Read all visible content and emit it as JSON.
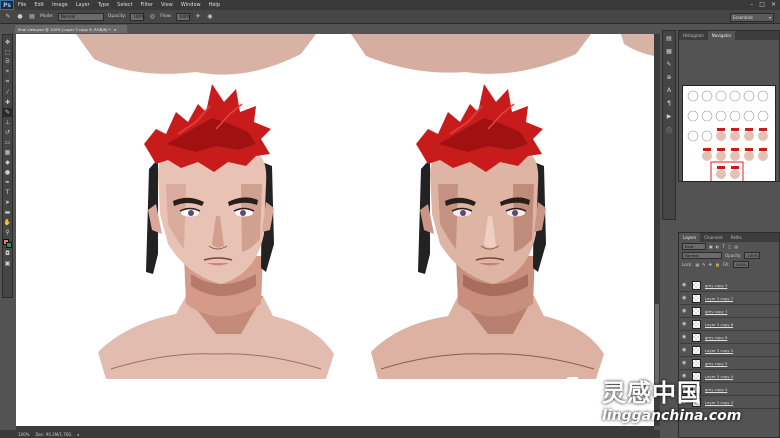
{
  "menubar": {
    "logo": "Ps",
    "items": [
      "File",
      "Edit",
      "Image",
      "Layer",
      "Type",
      "Select",
      "Filter",
      "View",
      "Window",
      "Help"
    ]
  },
  "options": {
    "mode_label": "Mode:",
    "mode_value": "Normal",
    "opacity_label": "Opacity:",
    "opacity_value": "100%",
    "flow_label": "Flow:",
    "flow_value": "100%",
    "workspace": "Essentials"
  },
  "document": {
    "tab_label": "final view.psd @ 100% (Layer 3 copy 6, RGB/8) *"
  },
  "statusbar": {
    "zoom": "100%",
    "doc_size": "Doc: 96.2M/1.76G"
  },
  "navigator": {
    "tabs": [
      "Histogram",
      "Navigator"
    ]
  },
  "layers": {
    "tabs": [
      "Layers",
      "Channels",
      "Paths"
    ],
    "kind_label": "Kind",
    "blend_mode": "Normal",
    "opacity_label": "Opacity:",
    "opacity_value": "100%",
    "lock_label": "Lock:",
    "fill_label": "Fill:",
    "fill_value": "100%",
    "items": [
      "grey copy 3",
      "Layer 3 copy 7",
      "grey copy 7",
      "Layer 3 copy 6",
      "grey copy 6",
      "Layer 3 copy 5",
      "grey copy 5",
      "Layer 3 copy 4",
      "grey copy 4",
      "Layer 3 copy 3"
    ]
  },
  "watermark": {
    "cn": "灵感中国",
    "en": "lingganchina.com"
  },
  "colors": {
    "accent": "#2e8c56",
    "foreground_swatch": "#d78476",
    "hair_red": "#c81c1c",
    "ui_dark": "#3a3a3a"
  }
}
